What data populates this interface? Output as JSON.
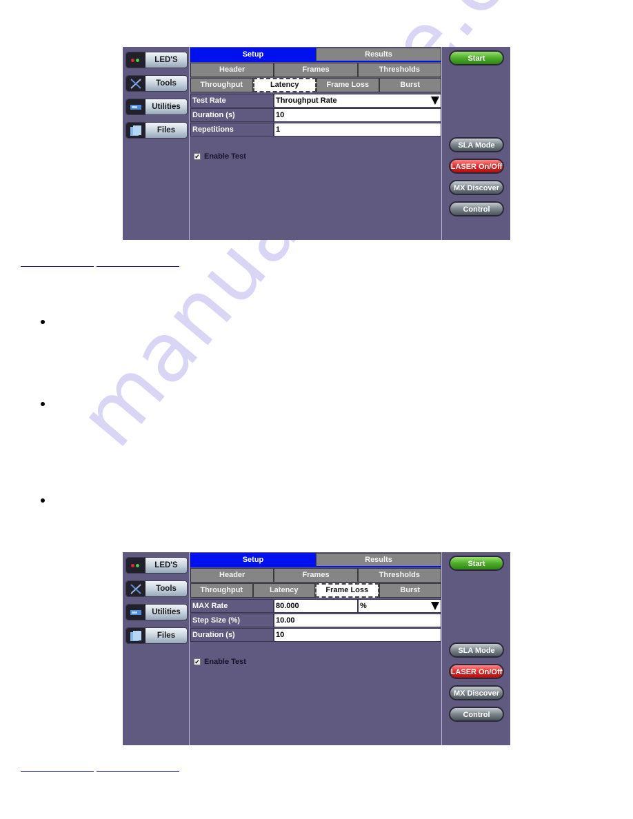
{
  "watermark": "manualshive.com",
  "screens": [
    {
      "sidebar": [
        {
          "label": "LED'S",
          "icon": "leds-icon"
        },
        {
          "label": "Tools",
          "icon": "tools-icon"
        },
        {
          "label": "Utilities",
          "icon": "utilities-icon"
        },
        {
          "label": "Files",
          "icon": "files-icon"
        }
      ],
      "top_tabs": [
        {
          "label": "Setup",
          "active": true
        },
        {
          "label": "Results",
          "active": false
        }
      ],
      "mid_tabs": [
        "Header",
        "Frames",
        "Thresholds"
      ],
      "low_tabs": [
        "Throughput",
        "Latency",
        "Frame Loss",
        "Burst"
      ],
      "selected_low_tab": "Latency",
      "fields": [
        {
          "label": "Test Rate",
          "value": "Throughput Rate",
          "type": "dropdown"
        },
        {
          "label": "Duration (s)",
          "value": "10"
        },
        {
          "label": "Repetitions",
          "value": "1"
        }
      ],
      "enable_test": {
        "label": "Enable Test",
        "checked": true,
        "mark": "✔"
      },
      "right_buttons": [
        "Start",
        "SLA Mode",
        "LASER On/Off",
        "MX Discover",
        "Control"
      ]
    },
    {
      "sidebar": [
        {
          "label": "LED'S",
          "icon": "leds-icon"
        },
        {
          "label": "Tools",
          "icon": "tools-icon"
        },
        {
          "label": "Utilities",
          "icon": "utilities-icon"
        },
        {
          "label": "Files",
          "icon": "files-icon"
        }
      ],
      "top_tabs": [
        {
          "label": "Setup",
          "active": true
        },
        {
          "label": "Results",
          "active": false
        }
      ],
      "mid_tabs": [
        "Header",
        "Frames",
        "Thresholds"
      ],
      "low_tabs": [
        "Throughput",
        "Latency",
        "Frame Loss",
        "Burst"
      ],
      "selected_low_tab": "Frame Loss",
      "fields": [
        {
          "label": "MAX Rate",
          "value": "80.000",
          "unit": "%",
          "type": "dropdown"
        },
        {
          "label": "Step Size (%)",
          "value": "10.00"
        },
        {
          "label": "Duration (s)",
          "value": "10"
        }
      ],
      "enable_test": {
        "label": "Enable Test",
        "checked": true,
        "mark": "✔"
      },
      "right_buttons": [
        "Start",
        "SLA Mode",
        "LASER On/Off",
        "MX Discover",
        "Control"
      ]
    }
  ],
  "colors": {
    "panel_bg": "#615a80",
    "setup_tab_active": "#0010ee",
    "tab_gray": "#858585",
    "start_green": "#4fae2b",
    "laser_red": "#e02828",
    "link_underline": "#0a0a8a",
    "watermark": "#d9d6f5"
  }
}
